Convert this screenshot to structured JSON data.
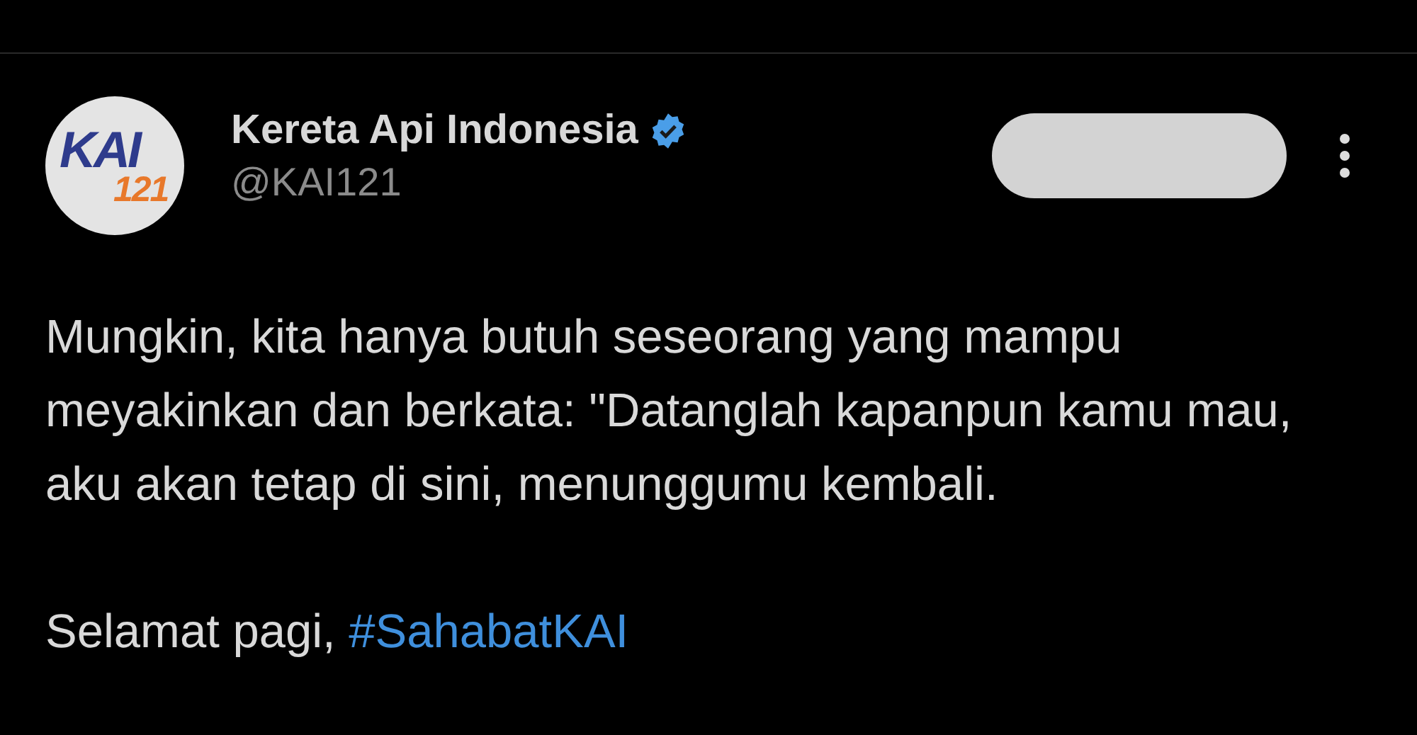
{
  "author": {
    "logo": {
      "main": "KAI",
      "sub": "121"
    },
    "name": "Kereta Api Indonesia",
    "verified": true,
    "handle": "@KAI121"
  },
  "follow_button": {
    "kind": "pill"
  },
  "paragraphs": [
    {
      "text": "Mungkin, kita hanya butuh seseorang yang mampu meyakinkan dan berkata: \"Datanglah kapanpun kamu mau, aku akan tetap di sini, menunggumu kembali."
    },
    {
      "text": "Selamat pagi, ",
      "hashtag": "#SahabatKAI"
    }
  ]
}
